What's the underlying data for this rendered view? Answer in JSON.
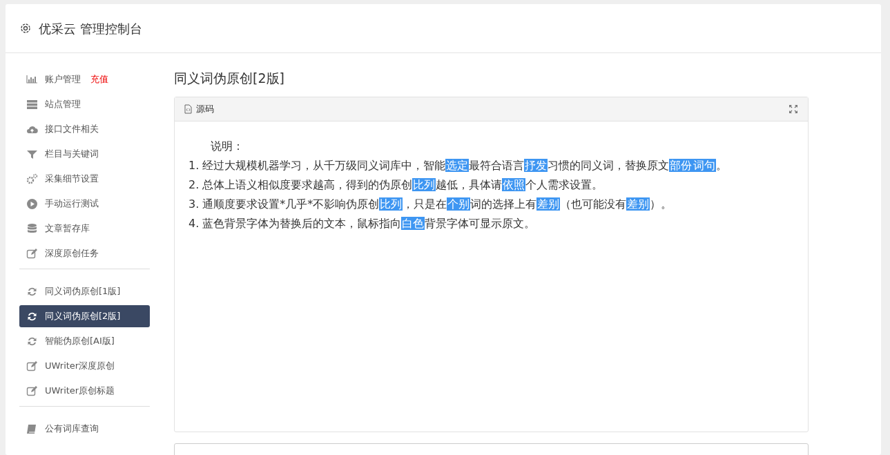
{
  "header": {
    "title": "优采云 管理控制台"
  },
  "sidebar": {
    "groups": [
      {
        "items": [
          {
            "label": "账户管理",
            "tag": "充值",
            "selected": false
          },
          {
            "label": "站点管理",
            "selected": false
          },
          {
            "label": "接口文件相关",
            "selected": false
          },
          {
            "label": "栏目与关键词",
            "selected": false
          },
          {
            "label": "采集细节设置",
            "selected": false
          },
          {
            "label": "手动运行测试",
            "selected": false
          },
          {
            "label": "文章暂存库",
            "selected": false
          },
          {
            "label": "深度原创任务",
            "selected": false
          }
        ]
      },
      {
        "items": [
          {
            "label": "同义词伪原创[1版]",
            "selected": false
          },
          {
            "label": "同义词伪原创[2版]",
            "selected": true
          },
          {
            "label": "智能伪原创[AI版]",
            "selected": false
          },
          {
            "label": "UWriter深度原创",
            "selected": false
          },
          {
            "label": "UWriter原创标题",
            "selected": false
          }
        ]
      },
      {
        "items": [
          {
            "label": "公有词库查询",
            "selected": false
          }
        ]
      }
    ]
  },
  "page": {
    "title": "同义词伪原创[2版]"
  },
  "panel": {
    "title": "源码",
    "intro": "说明：",
    "lines": [
      {
        "segments": [
          {
            "text": "1. 经过大规模机器学习，从千万级同义词库中，智能",
            "highlighted": false
          },
          {
            "text": "选定",
            "highlighted": true
          },
          {
            "text": "最符合语言",
            "highlighted": false
          },
          {
            "text": "抒发",
            "highlighted": true
          },
          {
            "text": "习惯的同义词，替换原文",
            "highlighted": false
          },
          {
            "text": "部份",
            "highlighted": true
          },
          {
            "text": "词句",
            "highlighted": true
          },
          {
            "text": "。",
            "highlighted": false
          }
        ]
      },
      {
        "segments": [
          {
            "text": "2. 总体上语义相似度要求越高，得到的伪原创",
            "highlighted": false
          },
          {
            "text": "比列",
            "highlighted": true
          },
          {
            "text": "越低，具体请",
            "highlighted": false
          },
          {
            "text": "依照",
            "highlighted": true
          },
          {
            "text": "个人需求设置。",
            "highlighted": false
          }
        ]
      },
      {
        "segments": [
          {
            "text": "3. 通顺度要求设置*几乎*不影响伪原创",
            "highlighted": false
          },
          {
            "text": "比列",
            "highlighted": true
          },
          {
            "text": "，只是在",
            "highlighted": false
          },
          {
            "text": "个别",
            "highlighted": true
          },
          {
            "text": "词的选择上有",
            "highlighted": false
          },
          {
            "text": "差别",
            "highlighted": true
          },
          {
            "text": "（也可能没有",
            "highlighted": false
          },
          {
            "text": "差别",
            "highlighted": true
          },
          {
            "text": "）。",
            "highlighted": false
          }
        ]
      },
      {
        "segments": [
          {
            "text": "4. 蓝色背景字体为替换后的文本，鼠标指向",
            "highlighted": false
          },
          {
            "text": "白色",
            "highlighted": true
          },
          {
            "text": "背景字体可显示原文。",
            "highlighted": false
          }
        ]
      }
    ]
  }
}
